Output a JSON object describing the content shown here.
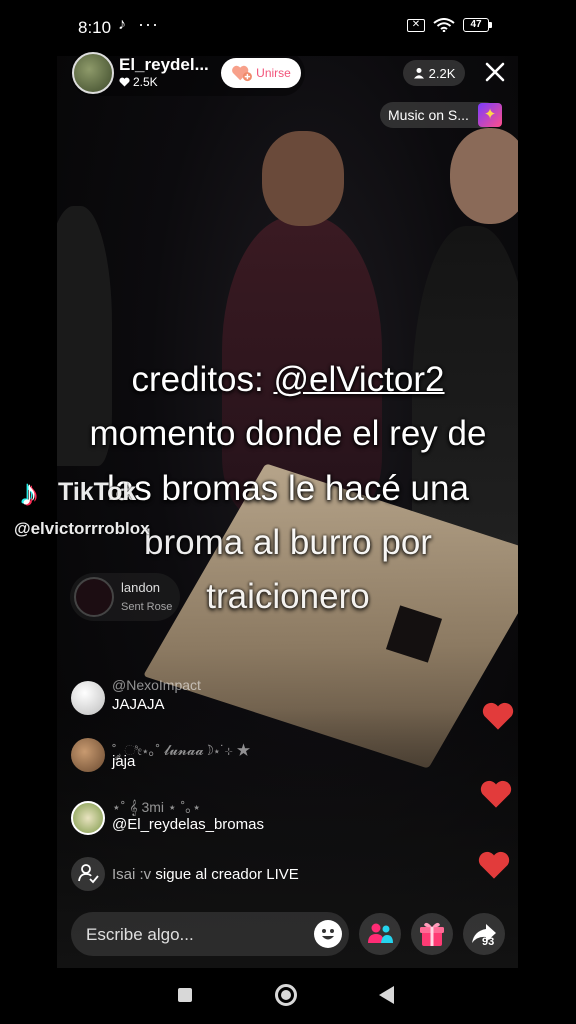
{
  "status_bar": {
    "time": "8:10",
    "app_glyph": "♪",
    "more": "···",
    "sim_label": "✕",
    "battery": "47"
  },
  "live": {
    "host_name": "El_reydel...",
    "host_likes": "2.5K",
    "join_label": "Unirse",
    "viewer_count": "2.2K",
    "music_label": "Music on S...",
    "accent_color": "#fe2c55"
  },
  "caption": {
    "line1_prefix": "creditos: ",
    "line1_handle": "@elVictor2",
    "line2": "momento donde el rey de",
    "line3": "las bromas le hacé una",
    "line4": "broma al burro por",
    "line5": "traicionero"
  },
  "watermark": {
    "logo_glyph": "♪",
    "brand": "TikTok",
    "handle": "@elvictorrrobloх"
  },
  "join_notice": {
    "name": "landon",
    "subtitle": "Sent Rose"
  },
  "comments": [
    {
      "user": "@NexoImpact",
      "text": "JAJAJA"
    },
    {
      "user": "˚ ༘ ೀ⋆｡˚ 𝓵𝓾𝓷𝓪𝓪☽⋆˙⊹ ★",
      "text": "jaja"
    },
    {
      "user": "⋆˚ 𝄞 3mi ⋆ ˚｡⋆",
      "text": "@El_reydelas_bromas"
    }
  ],
  "system_message": {
    "user": "Isai :v",
    "text": " sigue al creador LIVE"
  },
  "bottom_bar": {
    "input_placeholder": "Escribe algo...",
    "share_count": "93"
  }
}
